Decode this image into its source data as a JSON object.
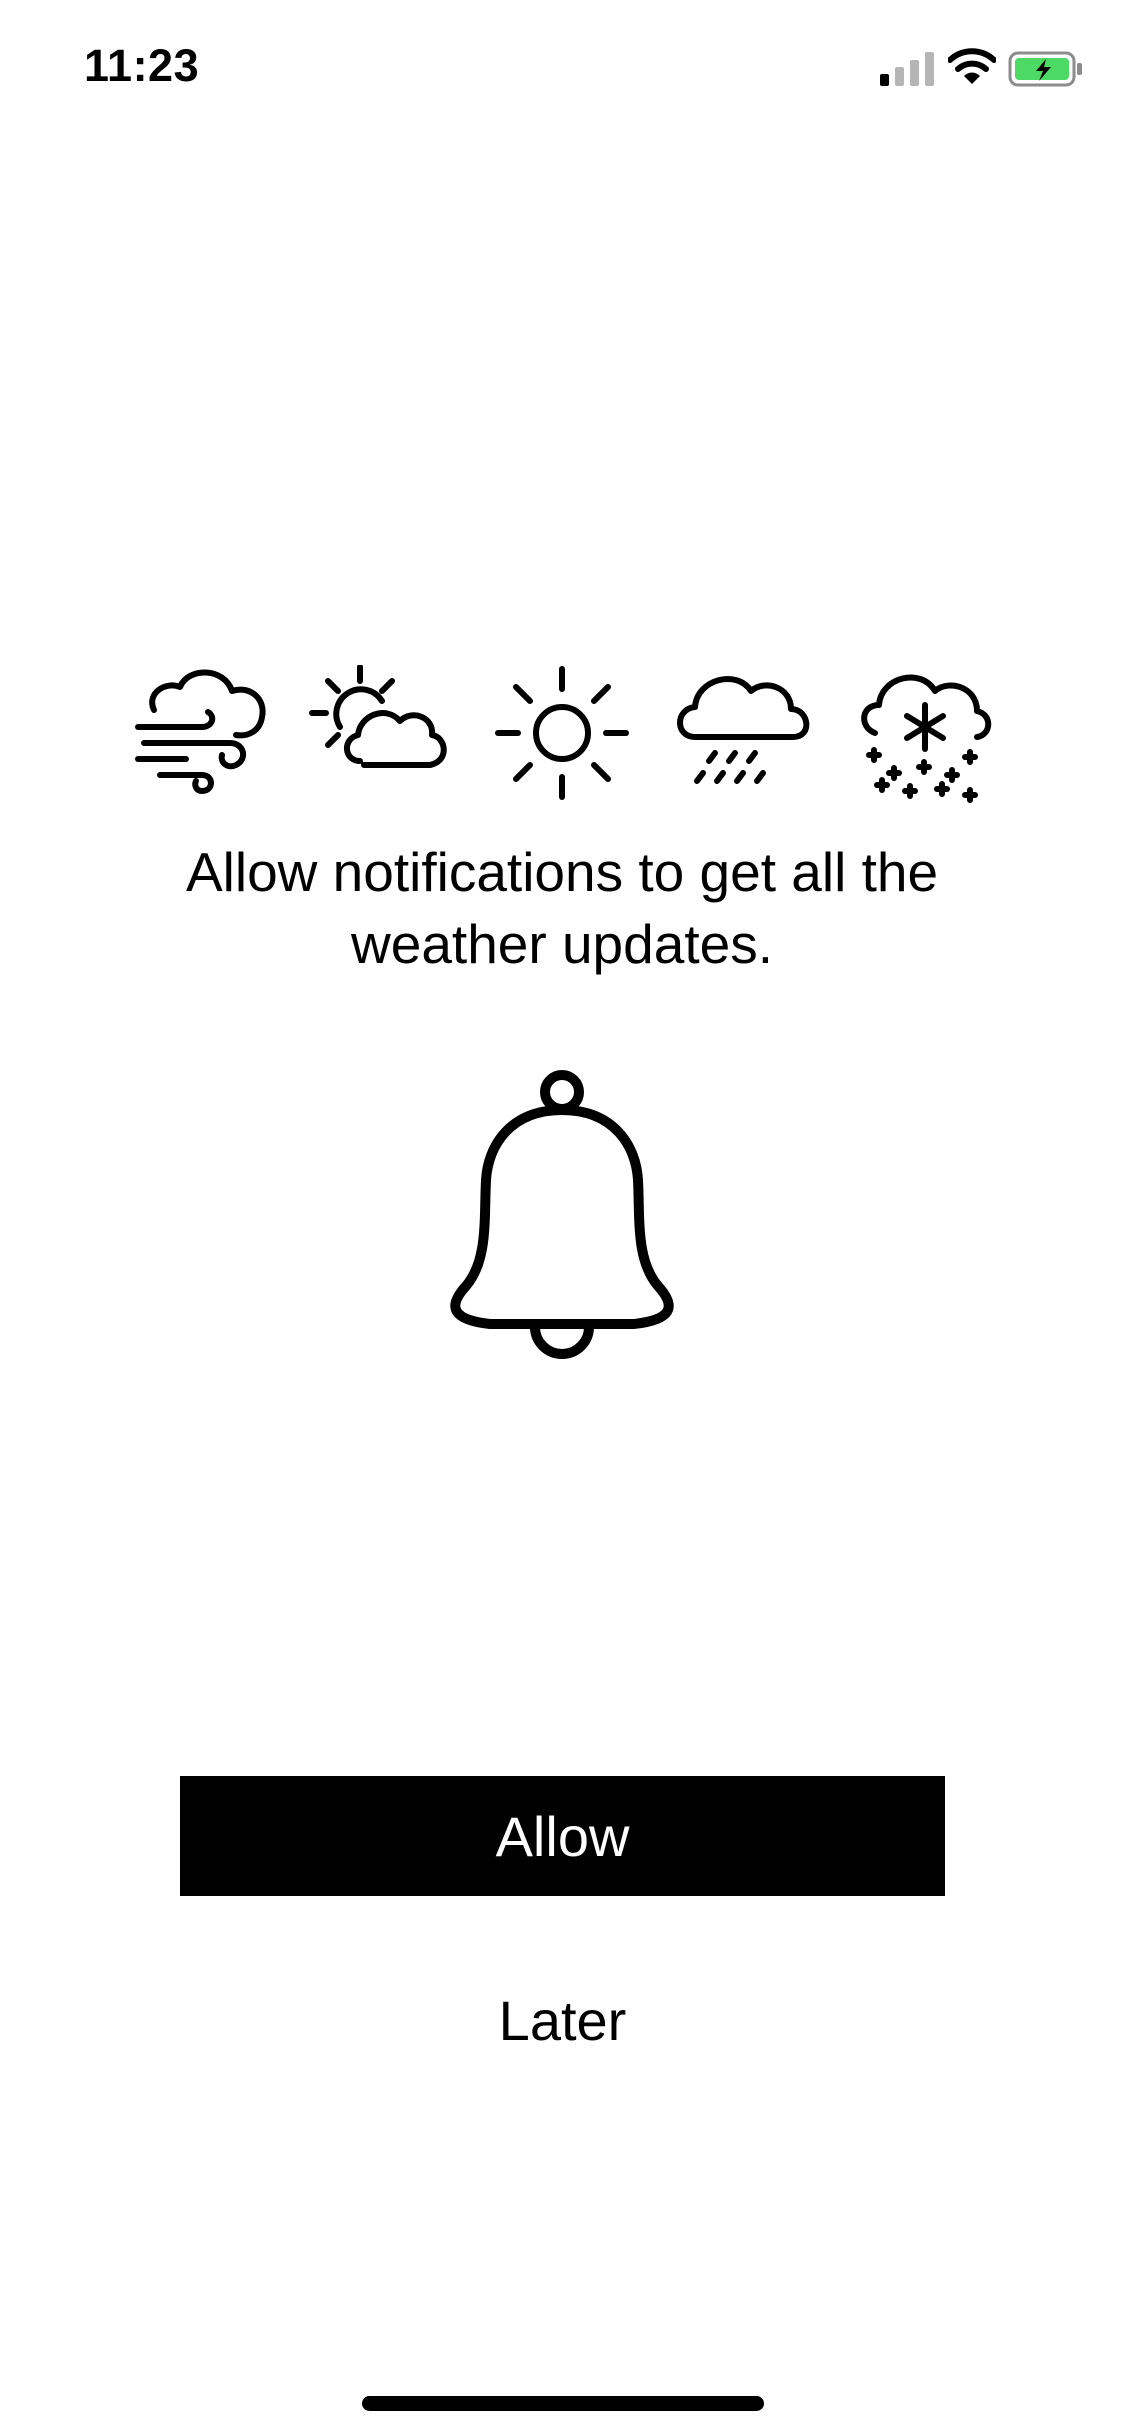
{
  "status_bar": {
    "time": "11:23",
    "signal_icon": "cellular-signal-icon",
    "wifi_icon": "wifi-icon",
    "battery_icon": "battery-charging-icon",
    "battery_color": "#4cd964"
  },
  "weather_icons": [
    "wind-cloud-icon",
    "partly-sunny-icon",
    "sun-icon",
    "rain-icon",
    "snow-icon"
  ],
  "message": {
    "line1": "Allow notifications to get all the",
    "line2": "weather updates."
  },
  "bell_icon": "bell-icon",
  "buttons": {
    "allow_label": "Allow",
    "later_label": "Later"
  },
  "colors": {
    "primary": "#000000",
    "background": "#ffffff"
  }
}
